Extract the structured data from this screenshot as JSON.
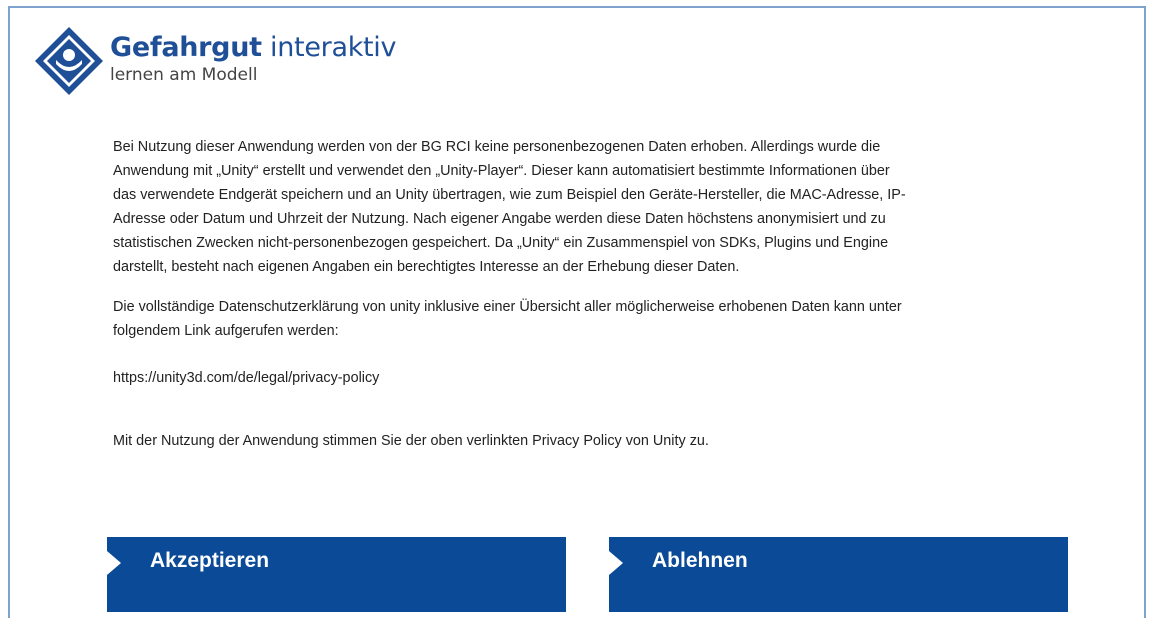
{
  "logo": {
    "icon": "gefahrgut-diamond-logo-icon",
    "title_bold": "Gefahrgut",
    "title_light": "interaktiv",
    "subtitle": "lernen am Modell",
    "brand_color": "#1f4f96"
  },
  "content": {
    "paragraph_1": "Bei Nutzung dieser Anwendung werden von der BG RCI keine personenbezogenen Daten erhoben. Allerdings wurde die Anwendung mit „Unity“ erstellt und verwendet den „Unity-Player“. Dieser kann automatisiert bestimmte Informationen über das verwendete Endgerät speichern und an Unity übertragen, wie zum Beispiel den Geräte-Hersteller, die MAC-Adresse, IP-Adresse oder Datum und Uhrzeit der Nutzung. Nach eigener Angabe werden diese Daten höchstens anonymisiert und zu statistischen Zwecken nicht-personenbezogen gespeichert. Da „Unity“ ein Zusammenspiel von SDKs, Plugins und Engine darstellt, besteht nach eigenen Angaben ein berechtigtes Interesse an der Erhebung dieser Daten.",
    "paragraph_2": "Die vollständige Datenschutzerklärung von unity inklusive einer Übersicht aller möglicherweise erhobenen Daten kann unter folgendem Link aufgerufen werden:",
    "link": "https://unity3d.com/de/legal/privacy-policy",
    "paragraph_3": "Mit der Nutzung der Anwendung stimmen Sie der oben verlinkten Privacy Policy von Unity zu."
  },
  "buttons": {
    "accept_label": "Akzeptieren",
    "decline_label": "Ablehnen",
    "color": "#0b4a96"
  }
}
